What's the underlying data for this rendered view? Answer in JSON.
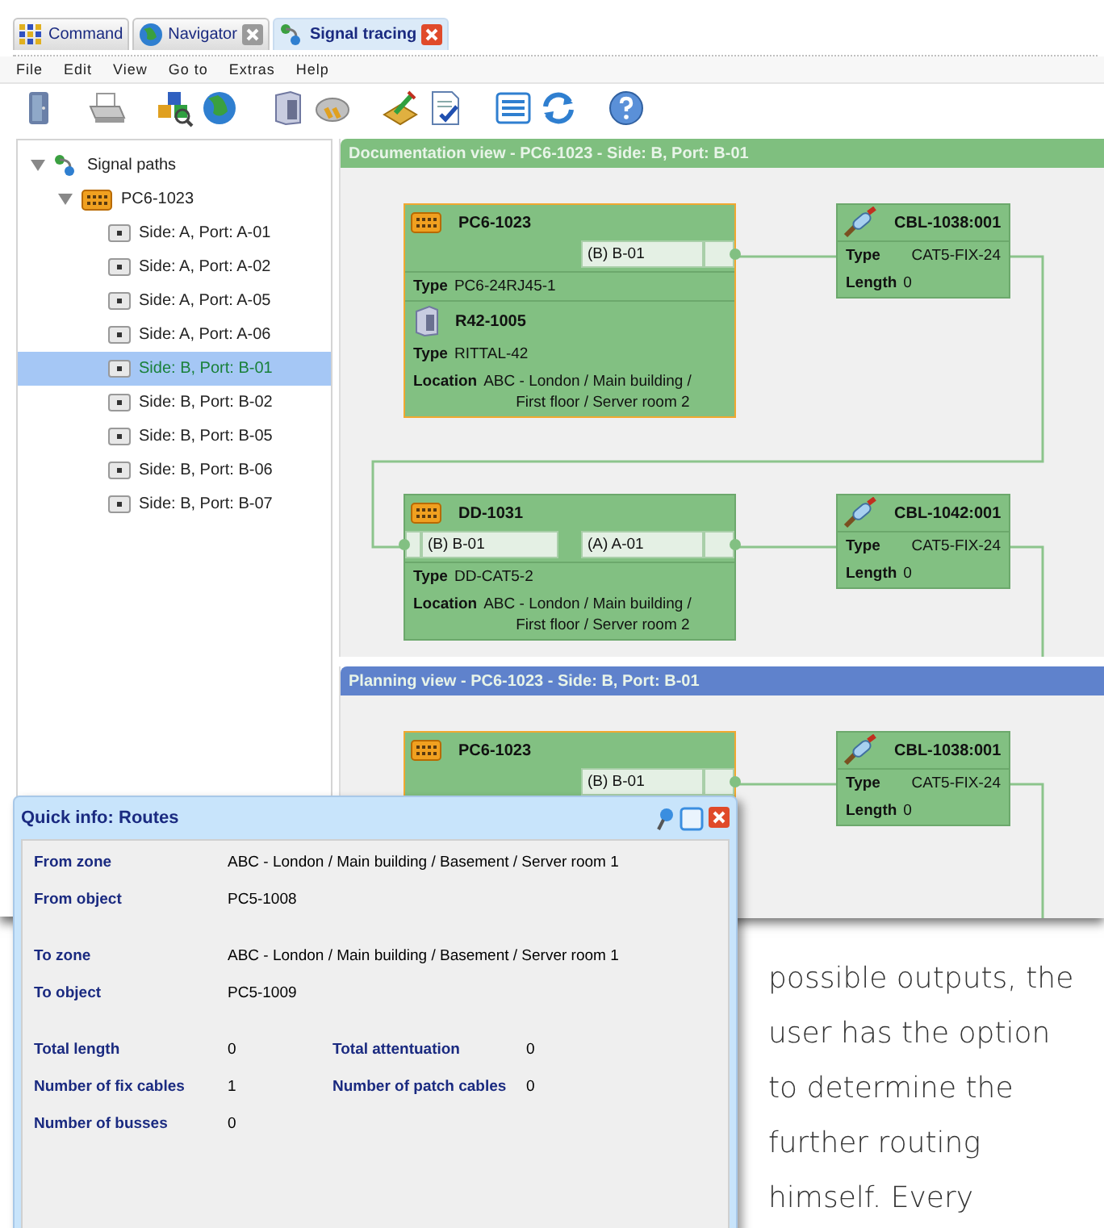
{
  "tabs": [
    {
      "label": "Command",
      "selected": false,
      "closable": false,
      "kind": "grid"
    },
    {
      "label": "Navigator",
      "selected": false,
      "closable": true,
      "kind": "globe"
    },
    {
      "label": "Signal tracing",
      "selected": true,
      "closable": true,
      "kind": "signal"
    }
  ],
  "menu": [
    "File",
    "Edit",
    "View",
    "Go to",
    "Extras",
    "Help"
  ],
  "tree": {
    "label": "Signal paths",
    "expanded": true,
    "children": [
      {
        "label": "PC6-1023",
        "expanded": true,
        "children": [
          {
            "label": "Side: A, Port: A-01",
            "selected": false
          },
          {
            "label": "Side: A, Port: A-02",
            "selected": false
          },
          {
            "label": "Side: A, Port: A-05",
            "selected": false
          },
          {
            "label": "Side: A, Port: A-06",
            "selected": false
          },
          {
            "label": "Side: B, Port: B-01",
            "selected": true
          },
          {
            "label": "Side: B, Port: B-02",
            "selected": false
          },
          {
            "label": "Side: B, Port: B-05",
            "selected": false
          },
          {
            "label": "Side: B, Port: B-06",
            "selected": false
          },
          {
            "label": "Side: B, Port: B-07",
            "selected": false
          }
        ]
      }
    ]
  },
  "views": [
    {
      "title": "Documentation view - PC6-1023 - Side: B, Port: B-01",
      "kind": "documentation",
      "nodes": [
        {
          "kind": "panel",
          "name": "PC6-1023",
          "selected": true,
          "ports": [
            {
              "label": "(B) B-01",
              "kind": "right"
            }
          ],
          "fields": [
            {
              "label": "Type",
              "value": "PC6-24RJ45-1"
            }
          ],
          "rack": {
            "name": "R42-1005",
            "fields": [
              {
                "label": "Type",
                "value": "RITTAL-42"
              },
              {
                "label": "Location",
                "value_lines": [
                  "ABC - London / Main building /",
                  "First floor / Server room 2"
                ]
              }
            ]
          }
        },
        {
          "kind": "cable",
          "name": "CBL-1038:001",
          "selected": false,
          "fields": [
            {
              "label": "Type",
              "value": "CAT5-FIX-24"
            },
            {
              "label": "Length",
              "value": "0"
            }
          ]
        },
        {
          "kind": "panel",
          "name": "DD-1031",
          "selected": false,
          "ports": [
            {
              "label": "(B) B-01",
              "kind": "left"
            },
            {
              "label": "(A) A-01",
              "kind": "right"
            }
          ],
          "fields": [
            {
              "label": "Type",
              "value": "DD-CAT5-2"
            },
            {
              "label": "Location",
              "value_lines": [
                "ABC - London / Main building /",
                "First floor / Server room 2"
              ]
            }
          ]
        },
        {
          "kind": "cable",
          "name": "CBL-1042:001",
          "selected": false,
          "fields": [
            {
              "label": "Type",
              "value": "CAT5-FIX-24"
            },
            {
              "label": "Length",
              "value": "0"
            }
          ]
        }
      ]
    },
    {
      "title": "Planning view - PC6-1023 - Side: B, Port: B-01",
      "kind": "planning",
      "nodes": [
        {
          "kind": "panel",
          "name": "PC6-1023",
          "selected": true,
          "ports": [
            {
              "label": "(B) B-01",
              "kind": "right"
            }
          ]
        },
        {
          "kind": "cable",
          "name": "CBL-1038:001",
          "selected": false,
          "fields": [
            {
              "label": "Type",
              "value": "CAT5-FIX-24"
            },
            {
              "label": "Length",
              "value": "0"
            }
          ]
        }
      ]
    }
  ],
  "quick_info": {
    "title": "Quick info: Routes",
    "groups": [
      [
        {
          "cells": [
            {
              "label": "From zone",
              "value": "ABC - London / Main building / Basement / Server room 1"
            }
          ]
        },
        {
          "cells": [
            {
              "label": "From object",
              "value": "PC5-1008"
            }
          ]
        }
      ],
      [
        {
          "cells": [
            {
              "label": "To zone",
              "value": "ABC - London / Main building / Basement / Server room 1"
            }
          ]
        },
        {
          "cells": [
            {
              "label": "To object",
              "value": "PC5-1009"
            }
          ]
        }
      ],
      [
        {
          "cells": [
            {
              "label": "Total length",
              "value": "0"
            },
            {
              "label": "Total attentuation",
              "value": "0"
            }
          ]
        },
        {
          "cells": [
            {
              "label": "Number of fix cables",
              "value": "1"
            },
            {
              "label": "Number of patch cables",
              "value": "0"
            }
          ]
        },
        {
          "cells": [
            {
              "label": "Number of busses",
              "value": "0"
            }
          ]
        }
      ]
    ]
  },
  "article": {
    "lines": [
      "possible outputs, the",
      "user has the option",
      "to determine the",
      "further routing",
      "himself. Every"
    ]
  }
}
